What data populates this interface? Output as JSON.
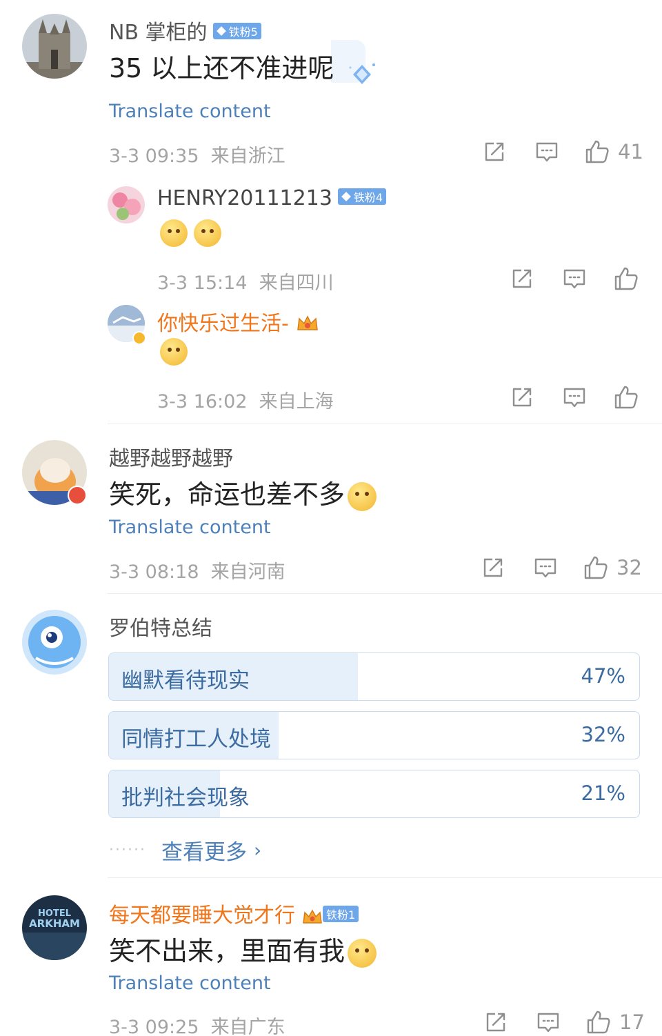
{
  "comments": [
    {
      "name": "NB 掌柜的",
      "badge": "铁粉5",
      "text": "35 以上还不准进呢",
      "translate": "Translate content",
      "time": "3-3 09:35",
      "location": "来自浙江",
      "likes": "41",
      "replies": [
        {
          "name": "HENRY20111213",
          "badge": "铁粉4",
          "time": "3-3 15:14",
          "location": "来自四川"
        },
        {
          "name": "你快乐过生活-",
          "time": "3-3 16:02",
          "location": "来自上海"
        }
      ]
    },
    {
      "name": "越野越野越野",
      "text": "笑死，命运也差不多",
      "translate": "Translate content",
      "time": "3-3 08:18",
      "location": "来自河南",
      "likes": "32"
    },
    {
      "name": "罗伯特总结",
      "poll": {
        "options": [
          {
            "label": "幽默看待现实",
            "pct": "47%",
            "value": 0.47
          },
          {
            "label": "同情打工人处境",
            "pct": "32%",
            "value": 0.32
          },
          {
            "label": "批判社会现象",
            "pct": "21%",
            "value": 0.21
          }
        ],
        "more": "查看更多"
      }
    },
    {
      "name": "每天都要睡大觉才行",
      "badge": "铁粉1",
      "text": "笑不出来，里面有我",
      "translate": "Translate content",
      "time": "3-3 09:25",
      "location": "来自广东",
      "likes": "17",
      "avatar_text": "HOTEL ARKHAM"
    }
  ],
  "colors": {
    "link": "#4d80b8",
    "orange": "#f0761c",
    "badge": "#6ea6ea",
    "meta": "#a4a4a4"
  },
  "icons": [
    "share-icon",
    "comment-icon",
    "like-icon"
  ]
}
